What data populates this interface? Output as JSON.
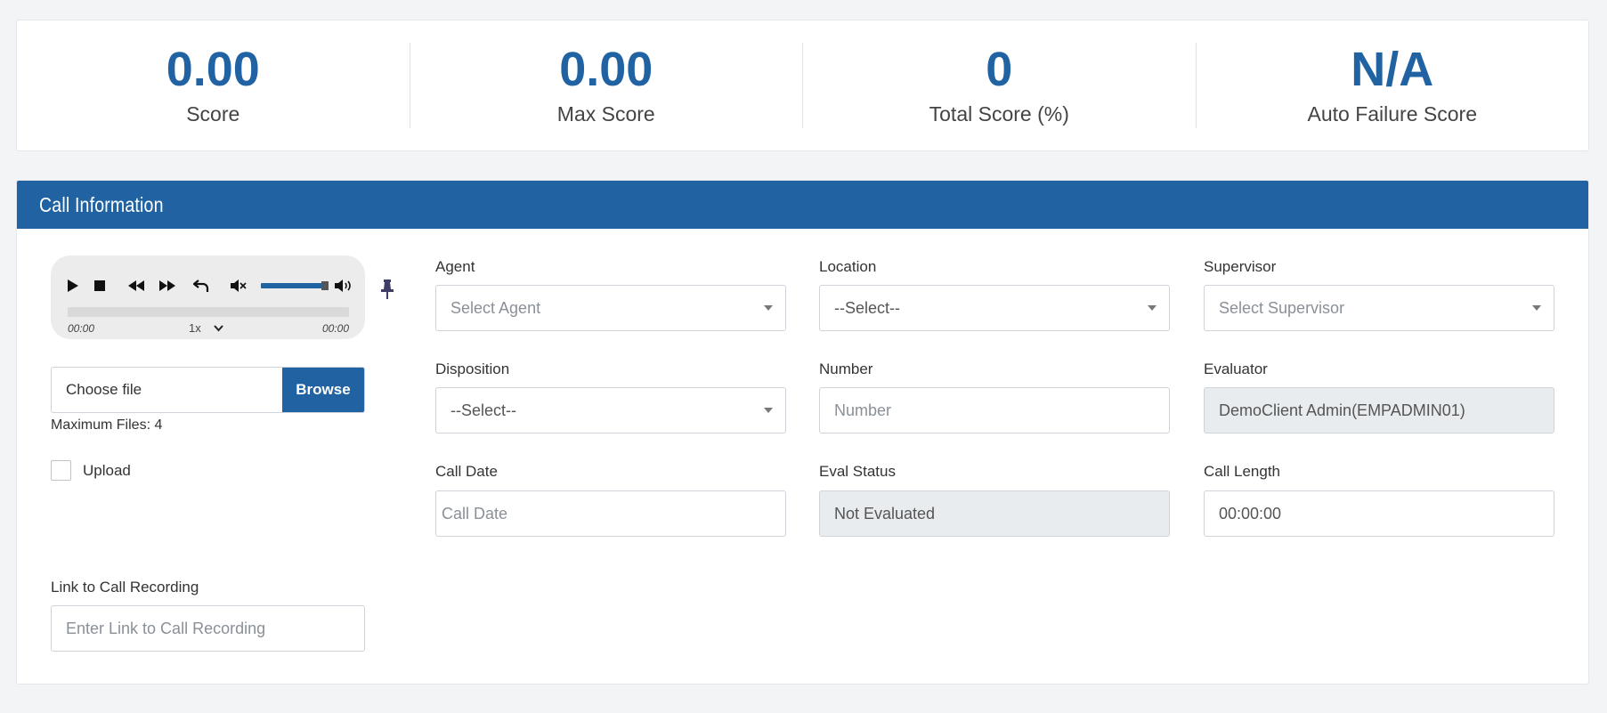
{
  "scores": [
    {
      "value": "0.00",
      "label": "Score"
    },
    {
      "value": "0.00",
      "label": "Max Score"
    },
    {
      "value": "0",
      "label": "Total Score (%)"
    },
    {
      "value": "N/A",
      "label": "Auto Failure Score"
    }
  ],
  "panel": {
    "title": "Call Information"
  },
  "player": {
    "current_time": "00:00",
    "duration": "00:00",
    "speed": "1x",
    "accent_color": "#2163a2"
  },
  "file": {
    "choose_label": "Choose file",
    "browse_label": "Browse",
    "max_files": "Maximum Files: 4"
  },
  "upload": {
    "label": "Upload"
  },
  "link": {
    "label": "Link to Call Recording",
    "placeholder": "Enter Link to Call Recording"
  },
  "fields": {
    "agent": {
      "label": "Agent",
      "value": "Select Agent"
    },
    "location": {
      "label": "Location",
      "value": "--Select--"
    },
    "supervisor": {
      "label": "Supervisor",
      "value": "Select Supervisor"
    },
    "disposition": {
      "label": "Disposition",
      "value": "--Select--"
    },
    "number": {
      "label": "Number",
      "placeholder": "Number"
    },
    "evaluator": {
      "label": "Evaluator",
      "value": "DemoClient Admin(EMPADMIN01)"
    },
    "call_date": {
      "label": "Call Date",
      "placeholder": "Call Date"
    },
    "eval_status": {
      "label": "Eval Status",
      "value": "Not Evaluated"
    },
    "call_length": {
      "label": "Call Length",
      "value": "00:00:00"
    }
  }
}
